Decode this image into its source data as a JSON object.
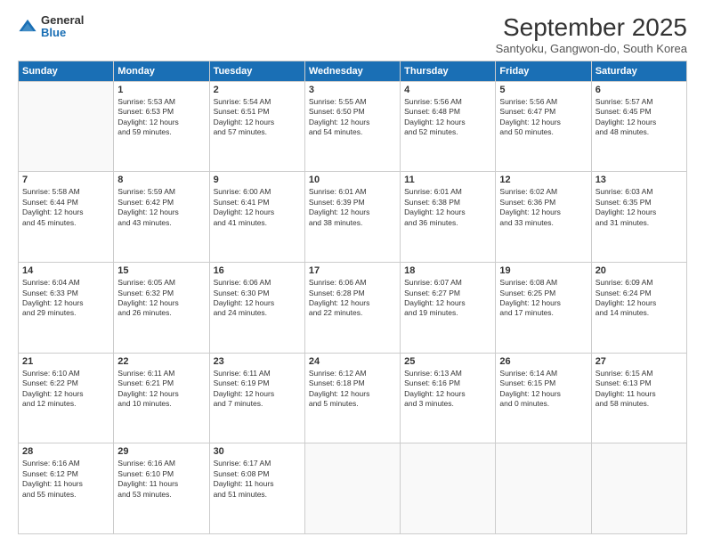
{
  "logo": {
    "general": "General",
    "blue": "Blue",
    "icon": "▶"
  },
  "title": "September 2025",
  "location": "Santyoku, Gangwon-do, South Korea",
  "days_of_week": [
    "Sunday",
    "Monday",
    "Tuesday",
    "Wednesday",
    "Thursday",
    "Friday",
    "Saturday"
  ],
  "weeks": [
    [
      {
        "day": "",
        "info": ""
      },
      {
        "day": "1",
        "info": "Sunrise: 5:53 AM\nSunset: 6:53 PM\nDaylight: 12 hours\nand 59 minutes."
      },
      {
        "day": "2",
        "info": "Sunrise: 5:54 AM\nSunset: 6:51 PM\nDaylight: 12 hours\nand 57 minutes."
      },
      {
        "day": "3",
        "info": "Sunrise: 5:55 AM\nSunset: 6:50 PM\nDaylight: 12 hours\nand 54 minutes."
      },
      {
        "day": "4",
        "info": "Sunrise: 5:56 AM\nSunset: 6:48 PM\nDaylight: 12 hours\nand 52 minutes."
      },
      {
        "day": "5",
        "info": "Sunrise: 5:56 AM\nSunset: 6:47 PM\nDaylight: 12 hours\nand 50 minutes."
      },
      {
        "day": "6",
        "info": "Sunrise: 5:57 AM\nSunset: 6:45 PM\nDaylight: 12 hours\nand 48 minutes."
      }
    ],
    [
      {
        "day": "7",
        "info": "Sunrise: 5:58 AM\nSunset: 6:44 PM\nDaylight: 12 hours\nand 45 minutes."
      },
      {
        "day": "8",
        "info": "Sunrise: 5:59 AM\nSunset: 6:42 PM\nDaylight: 12 hours\nand 43 minutes."
      },
      {
        "day": "9",
        "info": "Sunrise: 6:00 AM\nSunset: 6:41 PM\nDaylight: 12 hours\nand 41 minutes."
      },
      {
        "day": "10",
        "info": "Sunrise: 6:01 AM\nSunset: 6:39 PM\nDaylight: 12 hours\nand 38 minutes."
      },
      {
        "day": "11",
        "info": "Sunrise: 6:01 AM\nSunset: 6:38 PM\nDaylight: 12 hours\nand 36 minutes."
      },
      {
        "day": "12",
        "info": "Sunrise: 6:02 AM\nSunset: 6:36 PM\nDaylight: 12 hours\nand 33 minutes."
      },
      {
        "day": "13",
        "info": "Sunrise: 6:03 AM\nSunset: 6:35 PM\nDaylight: 12 hours\nand 31 minutes."
      }
    ],
    [
      {
        "day": "14",
        "info": "Sunrise: 6:04 AM\nSunset: 6:33 PM\nDaylight: 12 hours\nand 29 minutes."
      },
      {
        "day": "15",
        "info": "Sunrise: 6:05 AM\nSunset: 6:32 PM\nDaylight: 12 hours\nand 26 minutes."
      },
      {
        "day": "16",
        "info": "Sunrise: 6:06 AM\nSunset: 6:30 PM\nDaylight: 12 hours\nand 24 minutes."
      },
      {
        "day": "17",
        "info": "Sunrise: 6:06 AM\nSunset: 6:28 PM\nDaylight: 12 hours\nand 22 minutes."
      },
      {
        "day": "18",
        "info": "Sunrise: 6:07 AM\nSunset: 6:27 PM\nDaylight: 12 hours\nand 19 minutes."
      },
      {
        "day": "19",
        "info": "Sunrise: 6:08 AM\nSunset: 6:25 PM\nDaylight: 12 hours\nand 17 minutes."
      },
      {
        "day": "20",
        "info": "Sunrise: 6:09 AM\nSunset: 6:24 PM\nDaylight: 12 hours\nand 14 minutes."
      }
    ],
    [
      {
        "day": "21",
        "info": "Sunrise: 6:10 AM\nSunset: 6:22 PM\nDaylight: 12 hours\nand 12 minutes."
      },
      {
        "day": "22",
        "info": "Sunrise: 6:11 AM\nSunset: 6:21 PM\nDaylight: 12 hours\nand 10 minutes."
      },
      {
        "day": "23",
        "info": "Sunrise: 6:11 AM\nSunset: 6:19 PM\nDaylight: 12 hours\nand 7 minutes."
      },
      {
        "day": "24",
        "info": "Sunrise: 6:12 AM\nSunset: 6:18 PM\nDaylight: 12 hours\nand 5 minutes."
      },
      {
        "day": "25",
        "info": "Sunrise: 6:13 AM\nSunset: 6:16 PM\nDaylight: 12 hours\nand 3 minutes."
      },
      {
        "day": "26",
        "info": "Sunrise: 6:14 AM\nSunset: 6:15 PM\nDaylight: 12 hours\nand 0 minutes."
      },
      {
        "day": "27",
        "info": "Sunrise: 6:15 AM\nSunset: 6:13 PM\nDaylight: 11 hours\nand 58 minutes."
      }
    ],
    [
      {
        "day": "28",
        "info": "Sunrise: 6:16 AM\nSunset: 6:12 PM\nDaylight: 11 hours\nand 55 minutes."
      },
      {
        "day": "29",
        "info": "Sunrise: 6:16 AM\nSunset: 6:10 PM\nDaylight: 11 hours\nand 53 minutes."
      },
      {
        "day": "30",
        "info": "Sunrise: 6:17 AM\nSunset: 6:08 PM\nDaylight: 11 hours\nand 51 minutes."
      },
      {
        "day": "",
        "info": ""
      },
      {
        "day": "",
        "info": ""
      },
      {
        "day": "",
        "info": ""
      },
      {
        "day": "",
        "info": ""
      }
    ]
  ]
}
